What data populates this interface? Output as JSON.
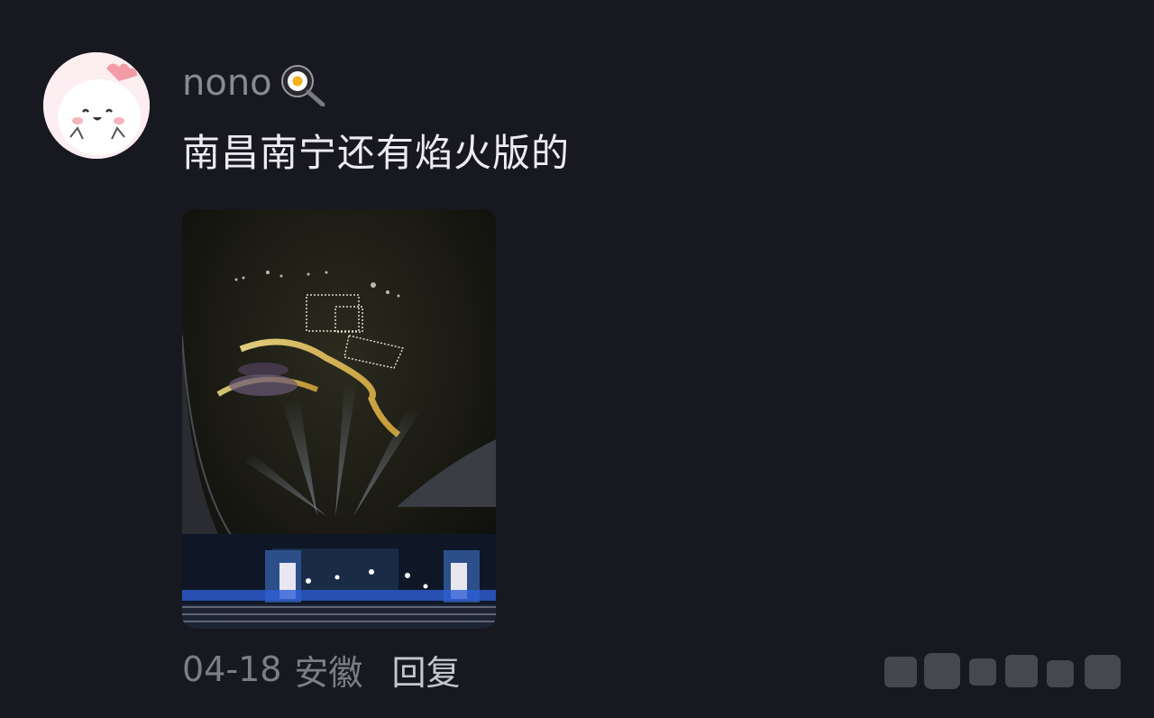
{
  "comment": {
    "username": "nono",
    "username_emoji": "frying-pan-egg-icon",
    "text": "南昌南宁还有焰火版的",
    "date": "04-18",
    "location": "安徽",
    "reply_label": "回复"
  },
  "colors": {
    "background": "#181820",
    "username": "#8a8a93",
    "text": "#ececf0",
    "meta": "#7d7d86",
    "reply": "#c6c6cd"
  }
}
